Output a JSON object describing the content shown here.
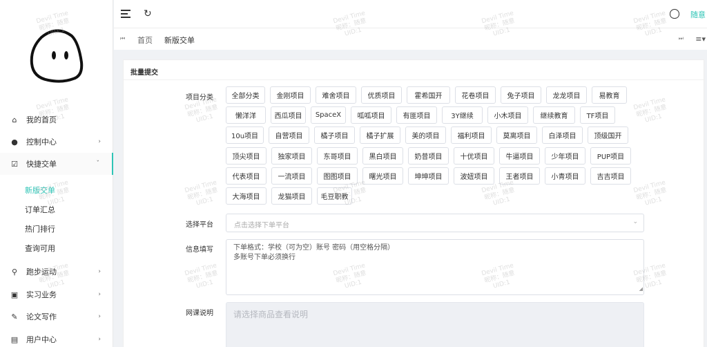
{
  "header": {
    "user_name": "随意"
  },
  "tabs": [
    {
      "label": "首页"
    },
    {
      "label": "新版交单"
    }
  ],
  "sidebar": {
    "items": [
      {
        "label": "我的首页",
        "icon": "home-icon"
      },
      {
        "label": "控制中心",
        "icon": "palette-icon"
      },
      {
        "label": "快捷交单",
        "icon": "check-square-icon"
      },
      {
        "label": "跑步运动",
        "icon": "run-icon"
      },
      {
        "label": "实习业务",
        "icon": "badge-icon"
      },
      {
        "label": "论文写作",
        "icon": "brush-icon"
      },
      {
        "label": "用户中心",
        "icon": "book-icon"
      }
    ],
    "subitems": [
      {
        "label": "新版交单",
        "active": true
      },
      {
        "label": "订单汇总"
      },
      {
        "label": "热门排行"
      },
      {
        "label": "查询可用"
      }
    ]
  },
  "card": {
    "title": "批量提交",
    "category_label": "项目分类",
    "categories": [
      [
        "全部分类",
        "金刚项目",
        "难舍项目",
        "优质项目",
        "霍希国开",
        "花卷项目",
        "兔子项目",
        "龙龙项目",
        "易教育"
      ],
      [
        "懒洋洋",
        "西瓜项目",
        "SpaceX",
        "呱呱项目",
        "有匪项目",
        "3Y继续",
        "小木项目",
        "继续教育",
        "TF项目"
      ],
      [
        "10u项目",
        "自营项目",
        "橘子项目",
        "橘子扩展",
        "美的项目",
        "福利项目",
        "莫离项目",
        "白泽项目",
        "顶级国开"
      ],
      [
        "顶尖项目",
        "独家项目",
        "东哥项目",
        "黑白项目",
        "奶昔项目",
        "十优项目",
        "牛逼项目",
        "少年项目",
        "PUP项目"
      ],
      [
        "代表项目",
        "一流项目",
        "图图项目",
        "曙光项目",
        "坤坤项目",
        "波妞项目",
        "王者项目",
        "小青项目",
        "吉吉项目"
      ],
      [
        "大海项目",
        "龙猫项目",
        "毛豆职教"
      ]
    ],
    "platform_label": "选择平台",
    "platform_placeholder": "点击选择下单平台",
    "info_label": "信息填写",
    "info_lines": [
      "下单格式：学校（可为空）账号 密码（用空格分隔）",
      "多账号下单必须换行"
    ],
    "course_label": "网课说明",
    "course_placeholder": "请选择商品查看说明"
  },
  "watermark": {
    "line1": "Devil Time",
    "line2": "昵称：随意",
    "line3": "UID:1"
  },
  "colors": {
    "accent": "#2ec4b6"
  }
}
